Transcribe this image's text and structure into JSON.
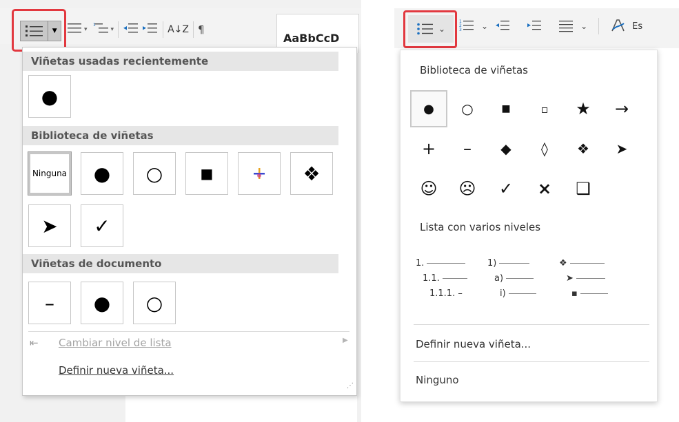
{
  "left": {
    "toolbar": {
      "style_label": "AaBbCcD",
      "pilcrow": "¶",
      "sort": "A↓Z",
      "colors": {
        "red_highlight": "#e2383f"
      }
    },
    "menu": {
      "section_recent": "Viñetas usadas recientemente",
      "section_library": "Biblioteca de viñetas",
      "section_document": "Viñetas de documento",
      "none_label": "Ninguna",
      "change_level": "Cambiar nivel de lista",
      "define_new": "Definir nueva viñeta...",
      "recent_bullets": [
        "●"
      ],
      "library_bullets": [
        "Ninguna",
        "●",
        "○",
        "■",
        "colored-cross-bullet",
        "❖",
        "➤",
        "✓"
      ],
      "document_bullets": [
        "–",
        "●",
        "○"
      ]
    }
  },
  "right": {
    "menu": {
      "library_title": "Biblioteca de viñetas",
      "library_bullets": [
        "●",
        "○",
        "■",
        "▫",
        "★",
        "→",
        "+",
        "–",
        "◆",
        "◊",
        "❖",
        "➤",
        "☺",
        "☹",
        "✓",
        "×",
        "❑"
      ],
      "multilevel_title": "Lista con varios niveles",
      "multilevel": [
        [
          "1.",
          "1.1.",
          "1.1.1. –"
        ],
        [
          "1)",
          "a)",
          "i)"
        ],
        [
          "❖",
          "➤",
          "▪"
        ]
      ],
      "define_new": "Definir nueva viñeta...",
      "none": "Ninguno"
    },
    "toolbar": {
      "style_label": "Es"
    }
  }
}
